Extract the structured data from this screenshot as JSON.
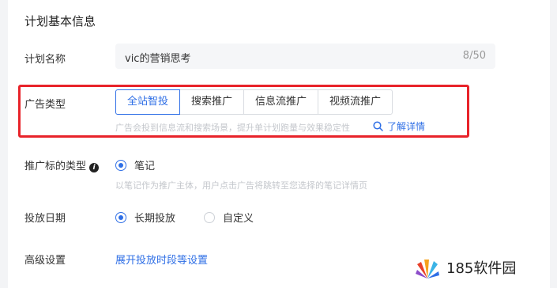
{
  "section": {
    "title": "计划基本信息"
  },
  "plan_name": {
    "label": "计划名称",
    "value": "vic的营销思考",
    "count": "8/50"
  },
  "ad_type": {
    "label": "广告类型",
    "options": [
      "全站智投",
      "搜索推广",
      "信息流推广",
      "视频流推广"
    ],
    "selected": "全站智投",
    "hint": "广告会投到信息流和搜索场景，提升单计划跑量与效果稳定性",
    "link": "了解详情"
  },
  "promo_target": {
    "label": "推广标的类型",
    "option": "笔记",
    "hint": "以笔记作为推广主体，用户点击广告将跳转至您选择的笔记详情页"
  },
  "schedule": {
    "label": "投放日期",
    "options": [
      "长期投放",
      "自定义"
    ],
    "selected": "长期投放"
  },
  "advanced": {
    "label": "高级设置",
    "link": "展开投放时段等设置"
  },
  "watermark": {
    "text": "185软件园"
  },
  "colors": {
    "accent": "#2f6fe6",
    "highlight": "#e8232a"
  }
}
